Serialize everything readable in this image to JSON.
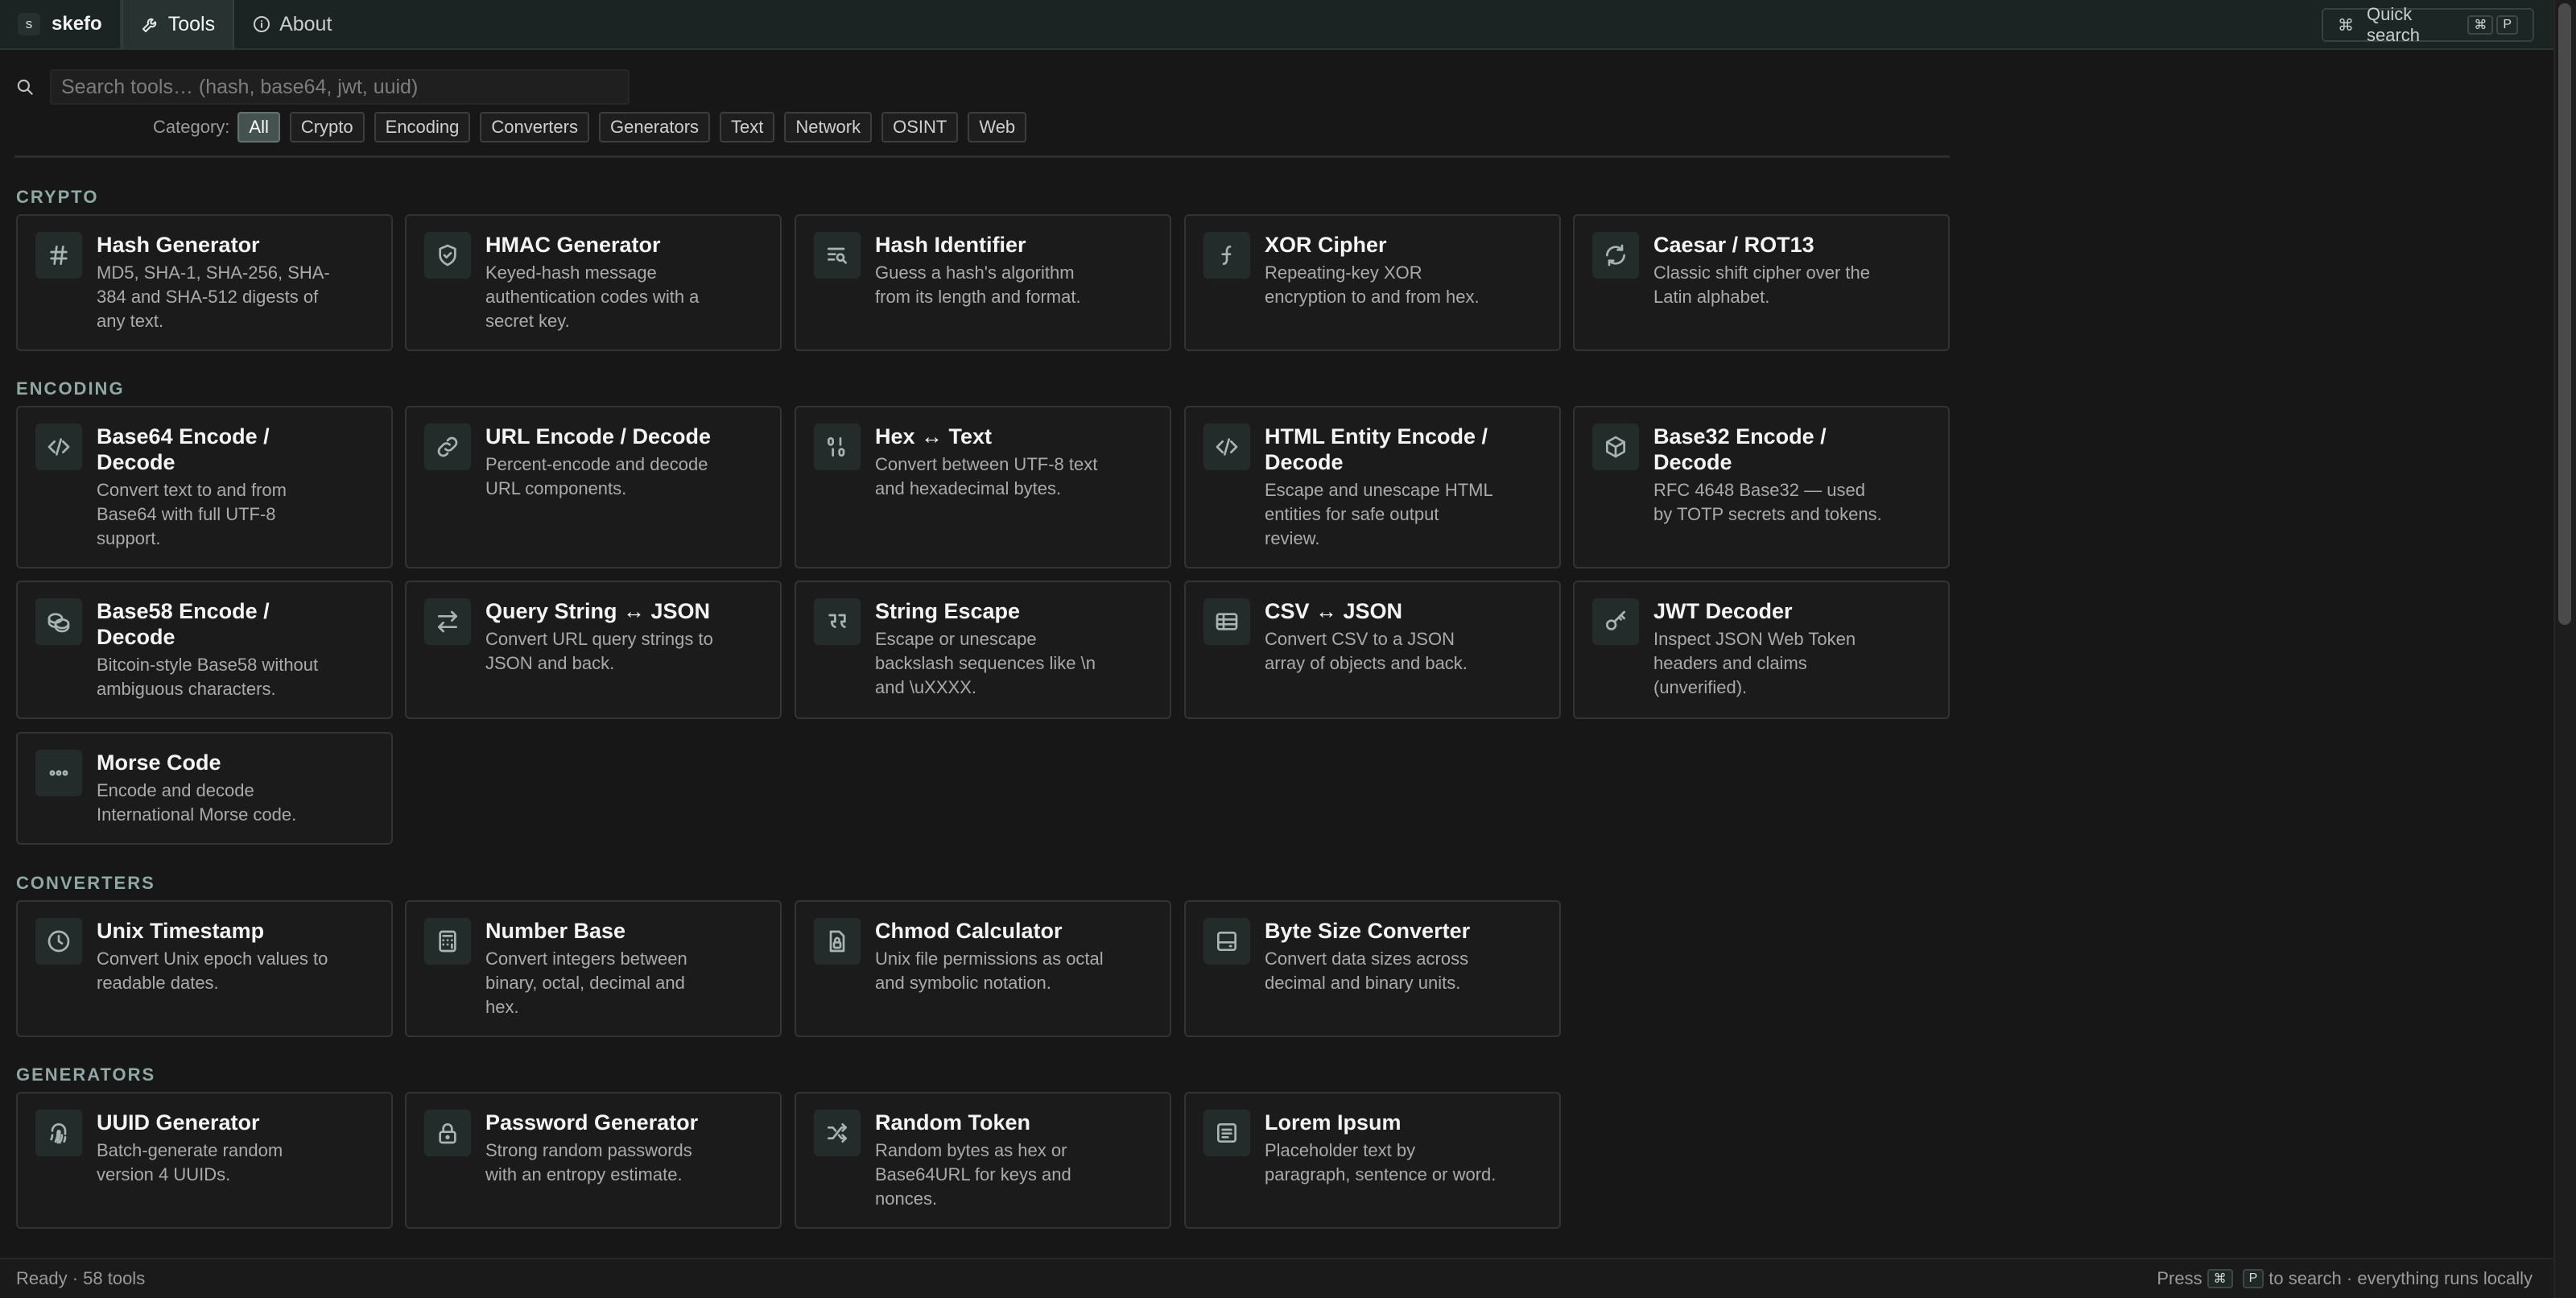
{
  "app": {
    "logo_letter": "s",
    "name": "skefo"
  },
  "nav": {
    "tabs": [
      {
        "label": "Tools",
        "icon": "wrench-icon",
        "active": true
      },
      {
        "label": "About",
        "icon": "info-icon",
        "active": false
      }
    ],
    "quick_search": {
      "label": "Quick search",
      "shortcut": [
        "⌘",
        "P"
      ]
    }
  },
  "search": {
    "placeholder": "Search tools… (hash, base64, jwt, uuid)",
    "value": ""
  },
  "categories": {
    "label": "Category:",
    "items": [
      "All",
      "Crypto",
      "Encoding",
      "Converters",
      "Generators",
      "Text",
      "Network",
      "OSINT",
      "Web"
    ],
    "selected": "All"
  },
  "sections": [
    {
      "title": "CRYPTO",
      "tools": [
        {
          "icon": "hash-icon",
          "title": "Hash Generator",
          "desc": "MD5, SHA-1, SHA-256, SHA-384 and SHA-512 digests of any text."
        },
        {
          "icon": "shield-check-icon",
          "title": "HMAC Generator",
          "desc": "Keyed-hash message authentication codes with a secret key."
        },
        {
          "icon": "text-search-icon",
          "title": "Hash Identifier",
          "desc": "Guess a hash's algorithm from its length and format."
        },
        {
          "icon": "function-icon",
          "title": "XOR Cipher",
          "desc": "Repeating-key XOR encryption to and from hex."
        },
        {
          "icon": "refresh-icon",
          "title": "Caesar / ROT13",
          "desc": "Classic shift cipher over the Latin alphabet."
        }
      ]
    },
    {
      "title": "ENCODING",
      "tools": [
        {
          "icon": "code-icon",
          "title": "Base64 Encode / Decode",
          "desc": "Convert text to and from Base64 with full UTF-8 support."
        },
        {
          "icon": "link-icon",
          "title": "URL Encode / Decode",
          "desc": "Percent-encode and decode URL components."
        },
        {
          "icon": "binary-icon",
          "title": "Hex ↔ Text",
          "desc": "Convert between UTF-8 text and hexadecimal bytes."
        },
        {
          "icon": "code-icon",
          "title": "HTML Entity Encode / Decode",
          "desc": "Escape and unescape HTML entities for safe output review."
        },
        {
          "icon": "box-icon",
          "title": "Base32 Encode / Decode",
          "desc": "RFC 4648 Base32 — used by TOTP secrets and tokens."
        },
        {
          "icon": "coins-icon",
          "title": "Base58 Encode / Decode",
          "desc": "Bitcoin-style Base58 without ambiguous characters."
        },
        {
          "icon": "arrows-exchange-icon",
          "title": "Query String ↔ JSON",
          "desc": "Convert URL query strings to JSON and back."
        },
        {
          "icon": "quote-icon",
          "title": "String Escape",
          "desc": "Escape or unescape backslash sequences like \\n and \\uXXXX."
        },
        {
          "icon": "table-icon",
          "title": "CSV ↔ JSON",
          "desc": "Convert CSV to a JSON array of objects and back."
        },
        {
          "icon": "key-icon",
          "title": "JWT Decoder",
          "desc": "Inspect JSON Web Token headers and claims (unverified)."
        },
        {
          "icon": "dots-icon",
          "title": "Morse Code",
          "desc": "Encode and decode International Morse code."
        }
      ]
    },
    {
      "title": "CONVERTERS",
      "tools": [
        {
          "icon": "clock-icon",
          "title": "Unix Timestamp",
          "desc": "Convert Unix epoch values to readable dates."
        },
        {
          "icon": "calculator-icon",
          "title": "Number Base",
          "desc": "Convert integers between binary, octal, decimal and hex."
        },
        {
          "icon": "file-lock-icon",
          "title": "Chmod Calculator",
          "desc": "Unix file permissions as octal and symbolic notation."
        },
        {
          "icon": "hard-drive-icon",
          "title": "Byte Size Converter",
          "desc": "Convert data sizes across decimal and binary units."
        }
      ]
    },
    {
      "title": "GENERATORS",
      "tools": [
        {
          "icon": "fingerprint-icon",
          "title": "UUID Generator",
          "desc": "Batch-generate random version 4 UUIDs."
        },
        {
          "icon": "lock-icon",
          "title": "Password Generator",
          "desc": "Strong random passwords with an entropy estimate."
        },
        {
          "icon": "shuffle-icon",
          "title": "Random Token",
          "desc": "Random bytes as hex or Base64URL for keys and nonces."
        },
        {
          "icon": "document-icon",
          "title": "Lorem Ipsum",
          "desc": "Placeholder text by paragraph, sentence or word."
        }
      ]
    }
  ],
  "status": {
    "left": "Ready · 58 tools",
    "press": "Press",
    "keys": [
      "⌘",
      "P"
    ],
    "right": "to search · everything runs locally"
  }
}
